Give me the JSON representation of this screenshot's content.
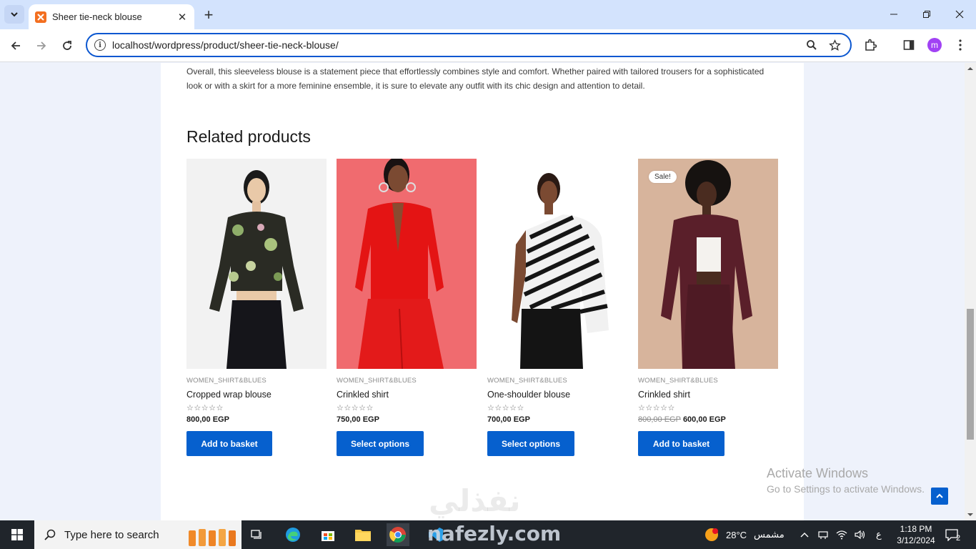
{
  "browser": {
    "tab_title": "Sheer tie-neck blouse",
    "url": "localhost/wordpress/product/sheer-tie-neck-blouse/",
    "profile_initial": "m"
  },
  "page": {
    "description": "Overall, this sleeveless blouse is a statement piece that effortlessly combines style and comfort. Whether paired with tailored trousers for a sophisticated look or with a skirt for a more feminine ensemble, it is sure to elevate any outfit with its chic design and attention to detail.",
    "related_title": "Related products",
    "products": [
      {
        "category": "WOMEN_SHIRT&BLUES",
        "name": "Cropped wrap blouse",
        "rating": "☆☆☆☆☆",
        "old_price": "",
        "price": "800,00 EGP",
        "button": "Add to basket",
        "badge": ""
      },
      {
        "category": "WOMEN_SHIRT&BLUES",
        "name": "Crinkled shirt",
        "rating": "☆☆☆☆☆",
        "old_price": "",
        "price": "750,00 EGP",
        "button": "Select options",
        "badge": ""
      },
      {
        "category": "WOMEN_SHIRT&BLUES",
        "name": "One-shoulder blouse",
        "rating": "☆☆☆☆☆",
        "old_price": "",
        "price": "700,00 EGP",
        "button": "Select options",
        "badge": ""
      },
      {
        "category": "WOMEN_SHIRT&BLUES",
        "name": "Crinkled shirt",
        "rating": "☆☆☆☆☆",
        "old_price": "800,00 EGP",
        "price": "600,00 EGP",
        "button": "Add to basket",
        "badge": "Sale!"
      }
    ]
  },
  "overlay": {
    "activate_title": "Activate Windows",
    "activate_sub": "Go to Settings to activate Windows.",
    "watermark_ar": "نفذلي",
    "watermark_en": "nafezly.com"
  },
  "taskbar": {
    "search_placeholder": "Type here to search",
    "weather_temp": "28°C",
    "weather_label": "مشمس",
    "lang": "ع",
    "time": "1:18 PM",
    "date": "3/12/2024",
    "notif_count": "2"
  },
  "colors": {
    "accent": "#0660ce",
    "tabstrip": "#d3e3fd",
    "taskbar": "#20252b"
  }
}
